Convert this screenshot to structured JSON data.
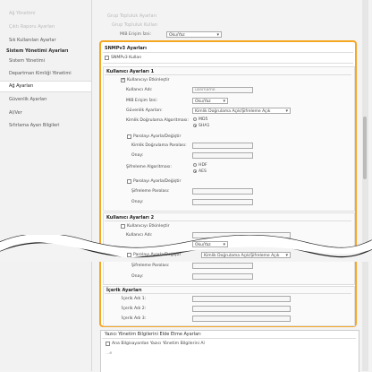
{
  "sidebar": {
    "items": [
      {
        "label": "Ağ Yönetimi",
        "faded": true
      },
      {
        "label": "Çıktı Raporu Ayarları",
        "faded": true
      },
      {
        "label": "Sık Kullanılan Ayarlar",
        "faded": false
      }
    ],
    "section_title": "Sistem Yönetimi Ayarları",
    "system_items": [
      {
        "label": "Sistem Yönetimi"
      },
      {
        "label": "Departman Kimliği Yönetimi"
      },
      {
        "label": "Ağ Ayarları",
        "active": true
      },
      {
        "label": "Güvenlik Ayarları"
      },
      {
        "label": "Al/Ver"
      },
      {
        "label": "Sıfırlama Ayarı Bilgileri"
      }
    ]
  },
  "top": {
    "faded_line_1": "Grup Topluluk Ayarları",
    "faded_line_2": "Grup Topluluk Kullan",
    "mib_label": "MIB Erişim İzni:",
    "mib_value": "Oku/Yaz"
  },
  "snmpv3": {
    "title": "SNMPv3 Ayarları",
    "use_label": "SNMPv3 Kullan",
    "user1": {
      "title": "Kullanıcı Ayarları 1",
      "enable_label": "Kullanıcıyı Etkinleştir",
      "username_label": "Kullanıcı Adı:",
      "username_value": "username",
      "mib_label": "MIB Erişim İzni:",
      "mib_value": "Oku/Yaz",
      "security_label": "Güvenlik Ayarları:",
      "security_value": "Kimlik Doğrulama Açık/Şifreleme Açık",
      "auth_algo_label": "Kimlik Doğrulama Algoritması:",
      "auth_opt_1": "MD5",
      "auth_opt_2": "SHA1",
      "set_password_label": "Parolayı Ayarla/Değiştir",
      "auth_password_label": "Kimlik Doğrulama Parolası:",
      "confirm_label": "Onay:",
      "enc_algo_label": "Şifreleme Algoritması:",
      "enc_opt_1": "HDF",
      "enc_opt_2": "AES",
      "set_password_label_2": "Parolayı Ayarla/Değiştir",
      "enc_password_label": "Şifreleme Parolası:",
      "confirm_label_2": "Onay:"
    },
    "user2": {
      "title": "Kullanıcı Ayarları 2",
      "enable_label": "Kullanıcıyı Etkinleştir",
      "username_label": "Kullanıcı Adı:",
      "mib_value": "Oku/Yaz",
      "set_password_label": "Parolayı Ayarla/Değiştir",
      "security_value": "Kimlik Doğrulama Açık/Şifreleme Açık",
      "enc_password_label": "Şifreleme Parolası:",
      "confirm_label": "Onay:"
    },
    "context": {
      "title": "İçerik Ayarları",
      "name1": "İçerik Adı 1:",
      "name2": "İçerik Adı 2:",
      "name3": "İçerik Adı 3:"
    }
  },
  "bottom": {
    "title": "Yazıcı Yönetim Bilgilerini Elde Etme Ayarları",
    "checkbox_label": "Ana Bilgisayardan Yazıcı Yönetim Bilgilerini Al",
    "extra": "...e"
  },
  "colors": {
    "highlight": "#f5a623"
  }
}
